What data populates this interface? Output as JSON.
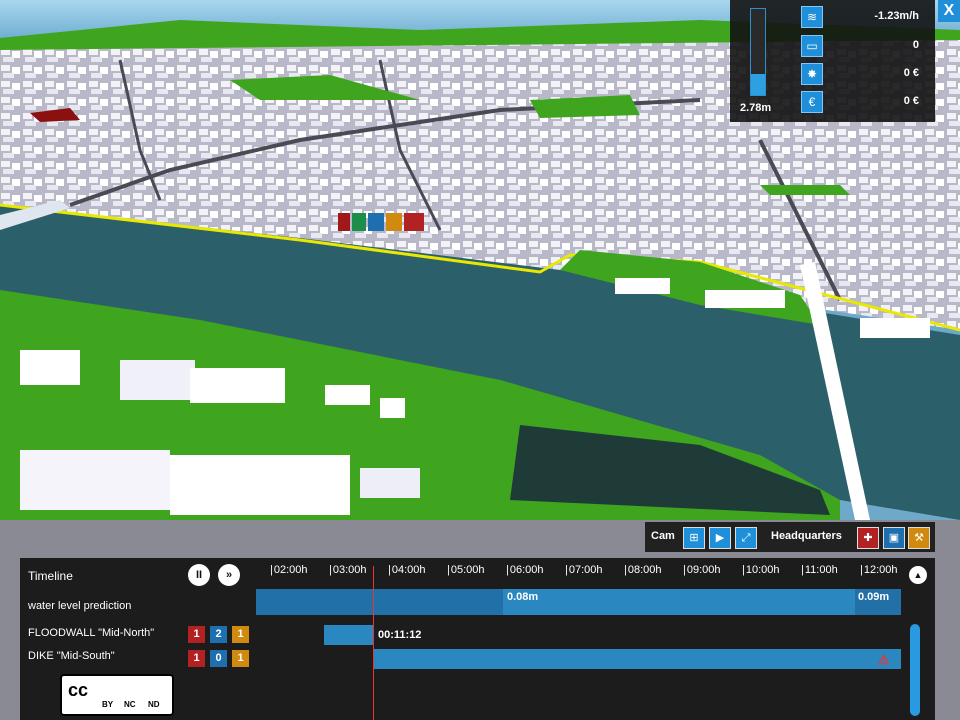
{
  "stats": {
    "water_level": "2.78m",
    "water_level_fraction": 0.25,
    "rows": [
      {
        "icon": "water-rate-icon",
        "value": "-1.23m/h"
      },
      {
        "icon": "battery-icon",
        "value": "0"
      },
      {
        "icon": "damage-icon",
        "value": "0 €"
      },
      {
        "icon": "euro-icon",
        "value": "0 €"
      }
    ],
    "close_label": "X"
  },
  "toolbar": {
    "cam_label": "Cam",
    "hq_label": "Headquarters"
  },
  "timeline": {
    "title": "Timeline",
    "pause_label": "II",
    "forward_label": "»",
    "ticks": [
      "02:00h",
      "03:00h",
      "04:00h",
      "05:00h",
      "06:00h",
      "07:00h",
      "08:00h",
      "09:00h",
      "10:00h",
      "11:00h",
      "12:00h"
    ],
    "water_label": "water level prediction",
    "water_marks": [
      "0.08m",
      "0.09m"
    ],
    "rows": [
      {
        "label": "FLOODWALL \"Mid-North\"",
        "badges": [
          "1",
          "2",
          "1"
        ],
        "bar_text": "00:11:12"
      },
      {
        "label": "DIKE \"Mid-South\"",
        "badges": [
          "1",
          "0",
          "1"
        ]
      }
    ],
    "cc_text": "cc",
    "cc_sub": [
      "BY",
      "NC",
      "ND"
    ]
  },
  "colors": {
    "accent": "#2e9fe0",
    "badge_red": "#b22222",
    "badge_blue": "#1e6fb0",
    "badge_orange": "#d08a10",
    "grass": "#3fa51e",
    "water": "#2b5f6a"
  }
}
